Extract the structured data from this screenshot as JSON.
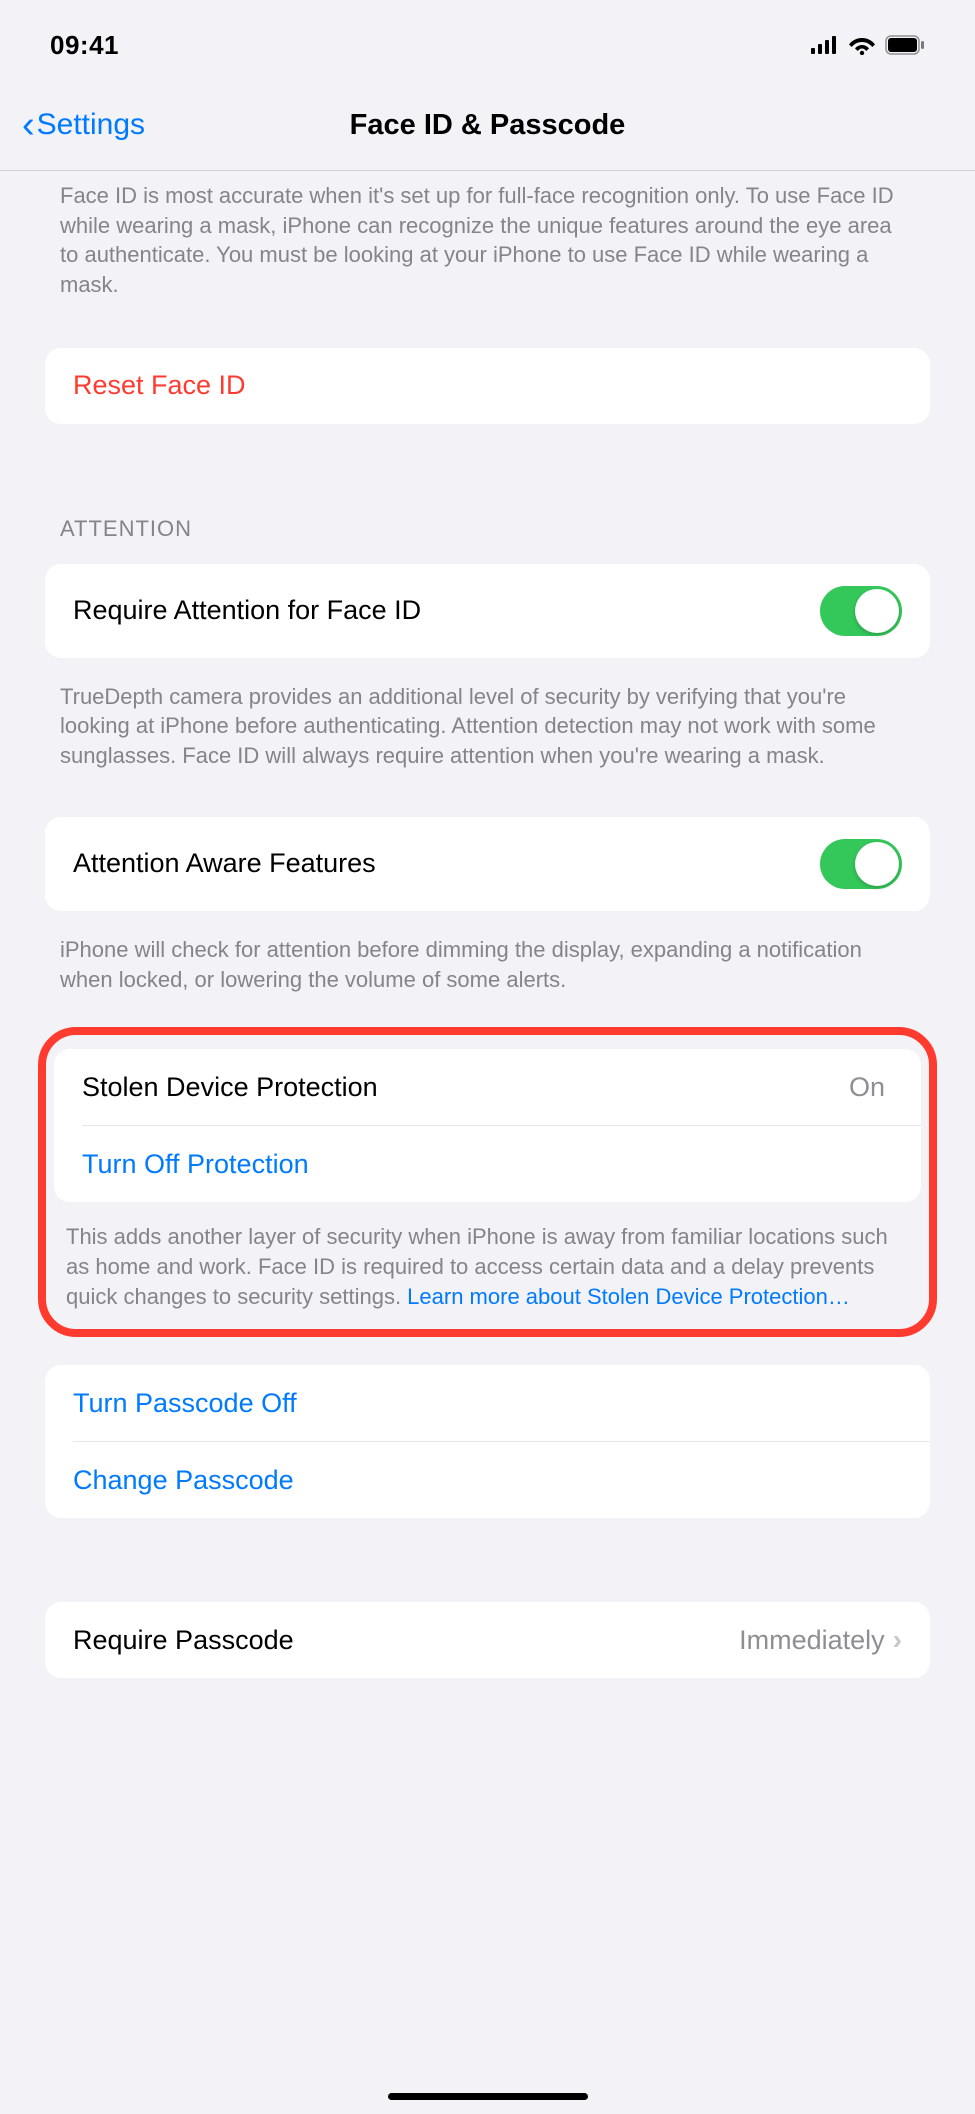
{
  "status": {
    "time": "09:41"
  },
  "nav": {
    "back_label": "Settings",
    "title": "Face ID & Passcode"
  },
  "faceid_footer": "Face ID is most accurate when it's set up for full-face recognition only. To use Face ID while wearing a mask, iPhone can recognize the unique features around the eye area to authenticate. You must be looking at your iPhone to use Face ID while wearing a mask.",
  "reset_faceid": "Reset Face ID",
  "attention": {
    "header": "ATTENTION",
    "require_label": "Require Attention for Face ID",
    "require_footer": "TrueDepth camera provides an additional level of security by verifying that you're looking at iPhone before authenticating. Attention detection may not work with some sunglasses. Face ID will always require attention when you're wearing a mask.",
    "aware_label": "Attention Aware Features",
    "aware_footer": "iPhone will check for attention before dimming the display, expanding a notification when locked, or lowering the volume of some alerts."
  },
  "sdp": {
    "label": "Stolen Device Protection",
    "value": "On",
    "turnoff": "Turn Off Protection",
    "footer_prefix": "This adds another layer of security when iPhone is away from familiar locations such as home and work. Face ID is required to access certain data and a delay prevents quick changes to security settings. ",
    "footer_link": "Learn more about Stolen Device Protection…"
  },
  "passcode": {
    "turnoff": "Turn Passcode Off",
    "change": "Change Passcode",
    "require_label": "Require Passcode",
    "require_value": "Immediately"
  }
}
